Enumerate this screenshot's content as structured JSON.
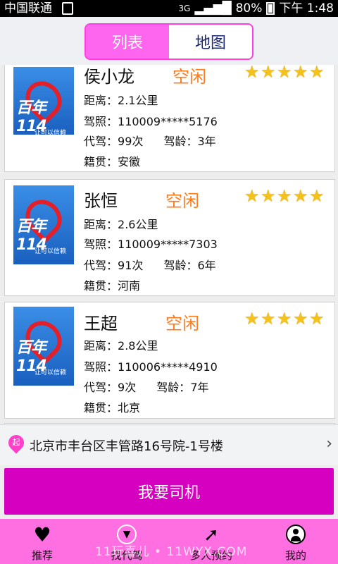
{
  "status_bar": {
    "carrier": "中国联通",
    "network": "3G",
    "battery": "80%",
    "time": "下午 1:48"
  },
  "segmented": {
    "list_label": "列表",
    "map_label": "地图",
    "active": "list"
  },
  "drivers": [
    {
      "name": "侯小龙",
      "status": "空闲",
      "rating": 5,
      "distance_label": "距离：",
      "distance": "2.1公里",
      "license_label": "驾照：",
      "license": "110009*****5176",
      "trips_label": "代驾：",
      "trips": "99次",
      "years_label": "驾龄：",
      "years": "3年",
      "origin_label": "籍贯：",
      "origin": "安徽",
      "logo_text": "百年114",
      "slogan": "让可以信赖"
    },
    {
      "name": "张恒",
      "status": "空闲",
      "rating": 5,
      "distance_label": "距离：",
      "distance": "2.6公里",
      "license_label": "驾照：",
      "license": "110009*****7303",
      "trips_label": "代驾：",
      "trips": "91次",
      "years_label": "驾龄：",
      "years": "6年",
      "origin_label": "籍贯：",
      "origin": "河南",
      "logo_text": "百年114",
      "slogan": "让可以信赖"
    },
    {
      "name": "王超",
      "status": "空闲",
      "rating": 5,
      "distance_label": "距离：",
      "distance": "2.8公里",
      "license_label": "驾照：",
      "license": "110006*****4910",
      "trips_label": "代驾：",
      "trips": "9次",
      "years_label": "驾龄：",
      "years": "7年",
      "origin_label": "籍贯：",
      "origin": "北京",
      "logo_text": "百年114",
      "slogan": "让可以信赖"
    }
  ],
  "address": {
    "pin_label": "起",
    "text": "北京市丰台区丰管路16号院-1号楼"
  },
  "primary_button": "我要司机",
  "tabs": [
    {
      "label": "推荐",
      "icon": "heart-icon"
    },
    {
      "label": "找代驾",
      "icon": "down-circle-icon"
    },
    {
      "label": "多人预约",
      "icon": "cursor-icon"
    },
    {
      "label": "我的",
      "icon": "user-icon"
    }
  ],
  "watermark": "11玩喜儿 • 11WYX.COM",
  "colors": {
    "accent": "#ff66f0",
    "primary_button": "#d500c0",
    "status_text": "#ff7a1a",
    "tabbar": "#ff6fe2",
    "star": "#f4c21a"
  }
}
